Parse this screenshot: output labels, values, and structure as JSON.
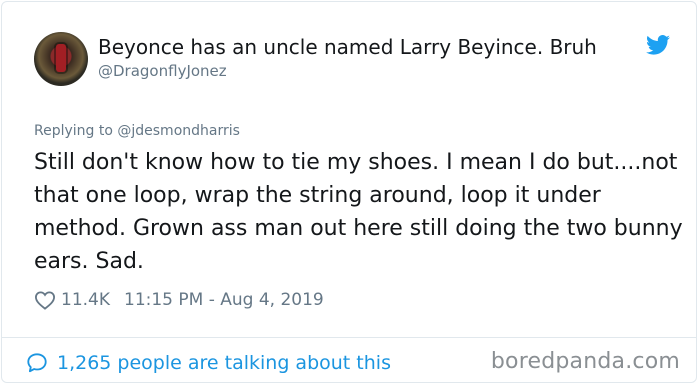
{
  "tweet": {
    "display_name": "Beyonce has an uncle named Larry Beyince. Bruh",
    "handle": "@DragonflyJonez",
    "reply_line": "Replying to @jdesmondharris",
    "text": "Still don't know how to tie my shoes. I mean I do but....not that one loop, wrap the string around, loop it under method. Grown ass man out here still doing the two bunny ears. Sad.",
    "likes": "11.4K",
    "timestamp": "11:15 PM - Aug 4, 2019",
    "talking": "1,265 people are talking about this"
  },
  "watermark": "boredpanda.com",
  "icons": {
    "brand": "twitter-bird-icon",
    "like": "heart-outline-icon",
    "replies": "speech-bubble-icon"
  },
  "colors": {
    "twitter_blue": "#1da1f2",
    "link_blue": "#1b95e0",
    "muted_gray": "#657786",
    "text": "#14171a"
  }
}
